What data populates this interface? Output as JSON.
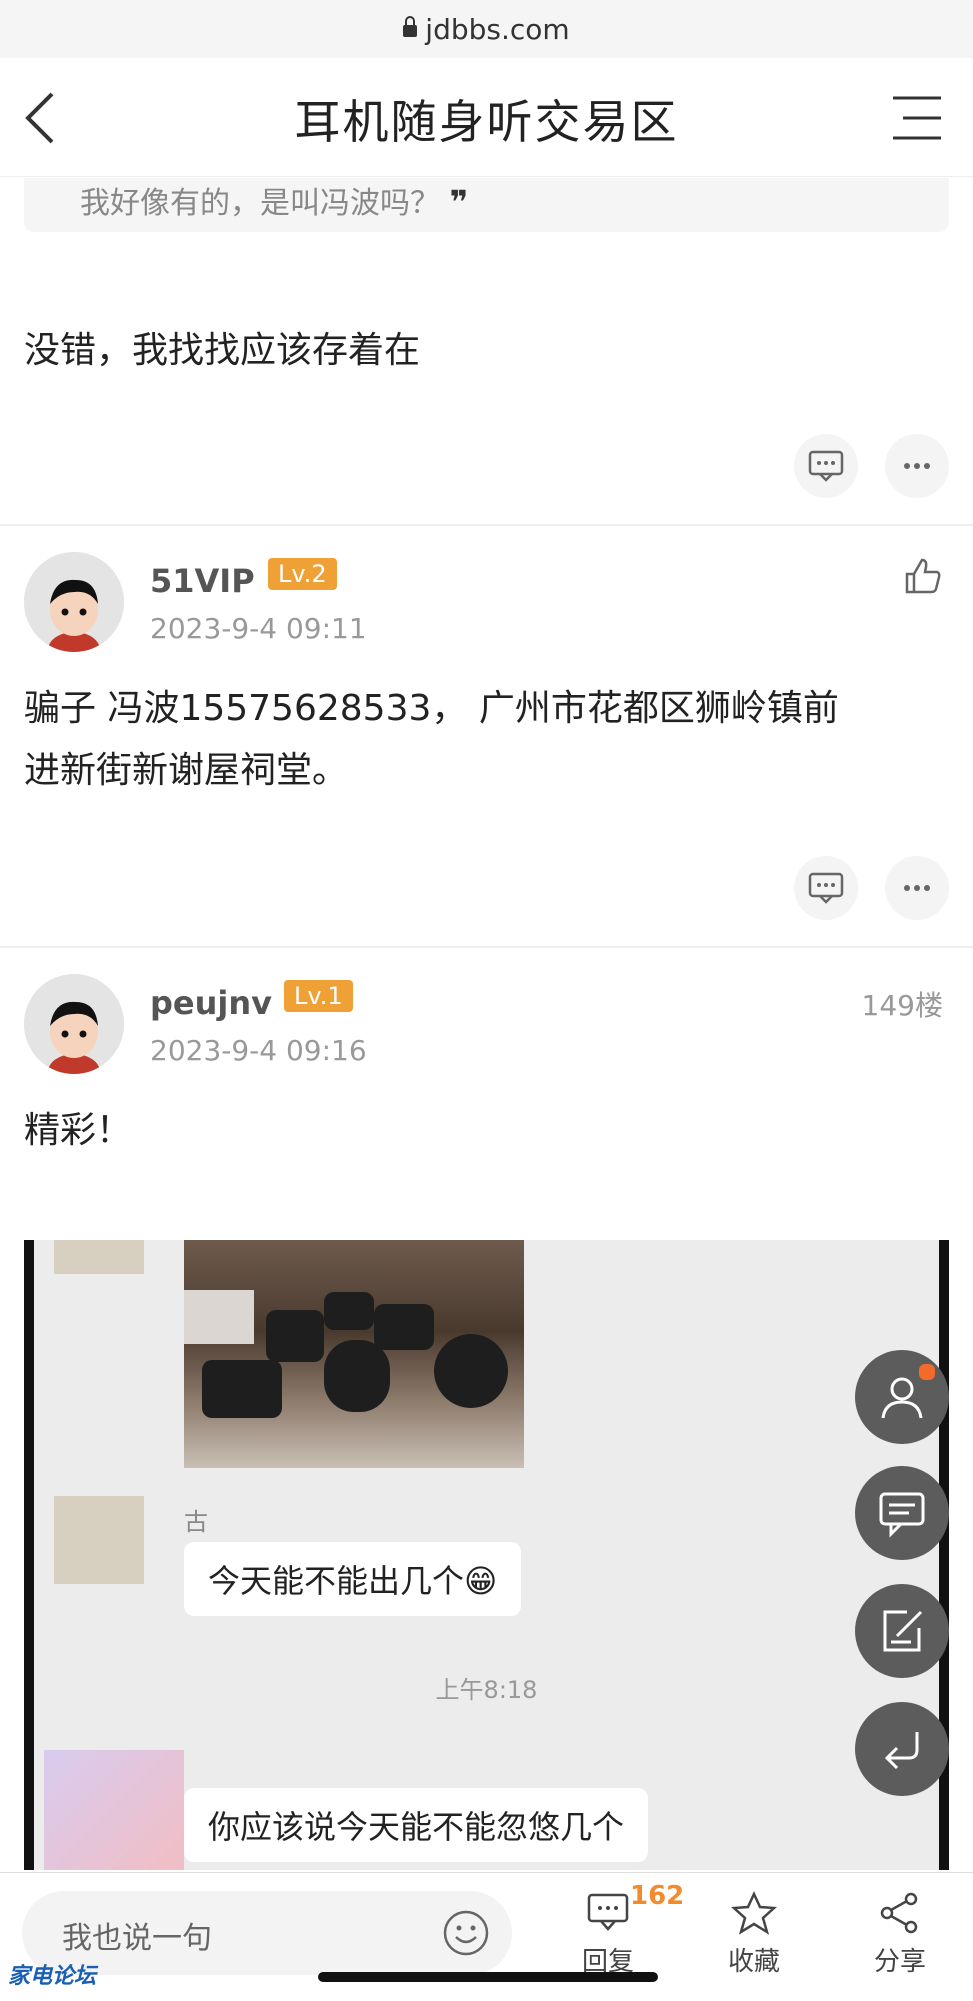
{
  "browser": {
    "url": "jdbbs.com"
  },
  "header": {
    "title": "耳机随身听交易区"
  },
  "quote": {
    "text": "我好像有的，是叫冯波吗？"
  },
  "posts": [
    {
      "text": "没错，我找找应该存着在"
    },
    {
      "user": "51VIP",
      "level": "Lv.2",
      "date": "2023-9-4 09:11",
      "text_line1": "骗子 冯波15575628533， 广州市花都区狮岭镇前",
      "text_line2": "进新街新谢屋祠堂。"
    },
    {
      "user": "peujnv",
      "level": "Lv.1",
      "date": "2023-9-4 09:16",
      "floor": "149楼",
      "text": "精彩！"
    }
  ],
  "chat_image": {
    "sender": "古",
    "message1": "今天能不能出几个😁",
    "time": "上午8:18",
    "message2": "你应该说今天能不能忽悠几个"
  },
  "bottom_bar": {
    "reply_placeholder": "我也说一句",
    "reply_label": "回复",
    "reply_count": "162",
    "favorite_label": "收藏",
    "share_label": "分享",
    "logo_text": "家电论坛"
  },
  "colors": {
    "level_badge": "#f0a135",
    "count": "#f28a2e",
    "fab": "#5c5c5c"
  }
}
